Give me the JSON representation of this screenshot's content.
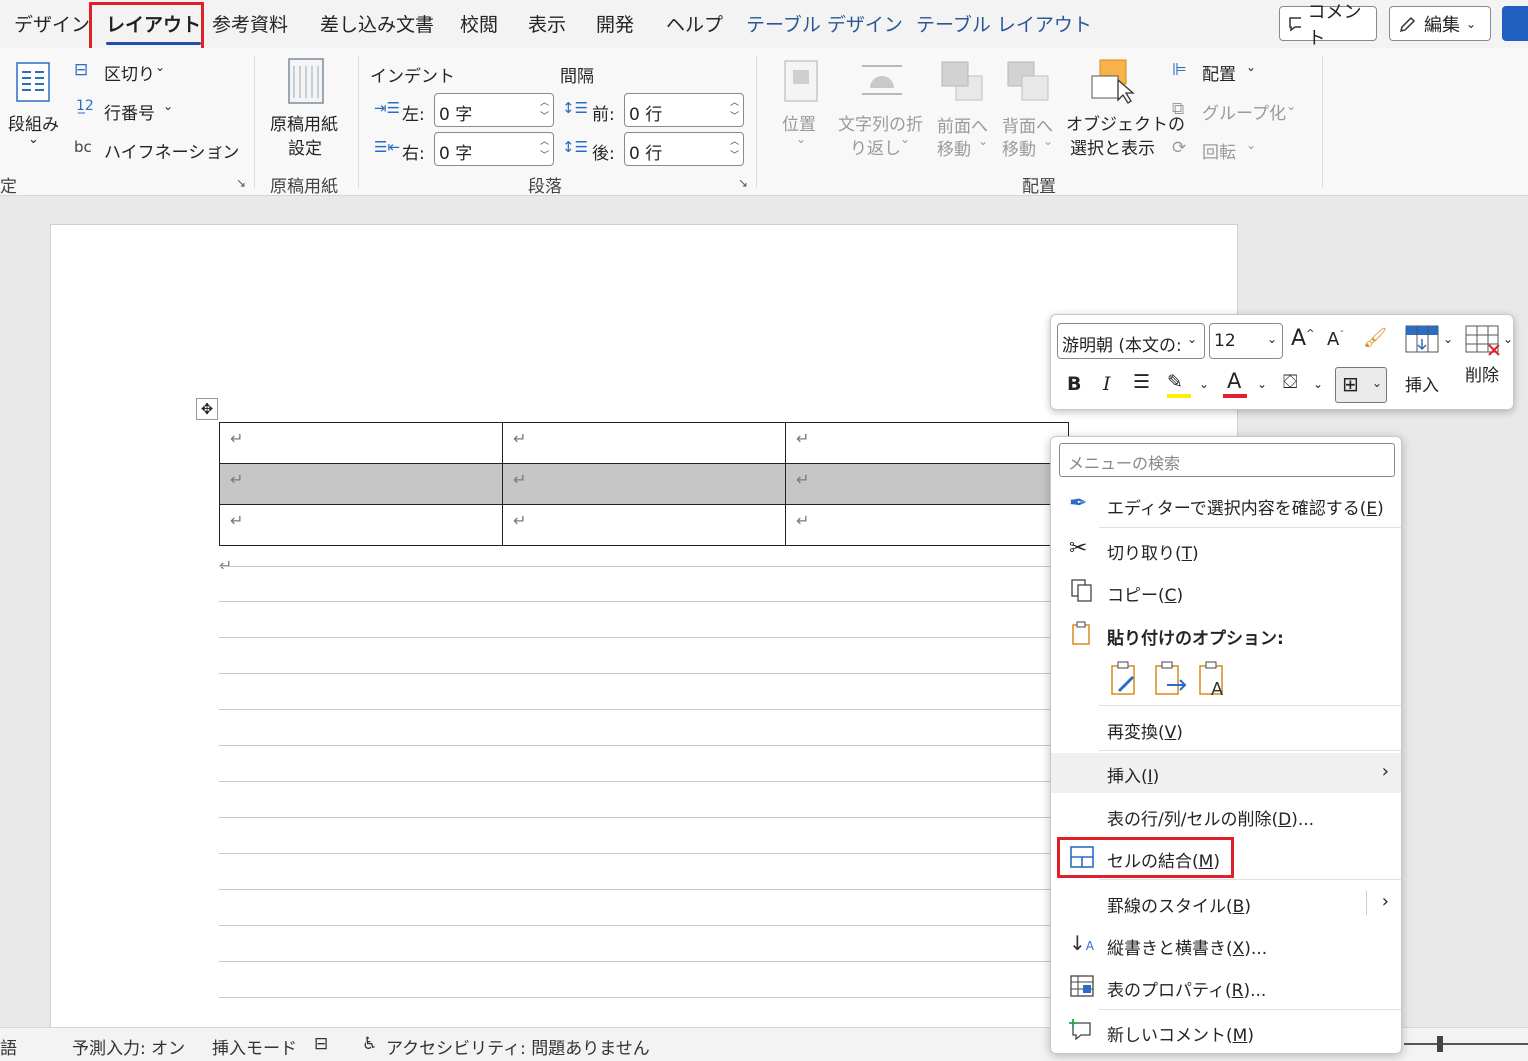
{
  "tabs": [
    {
      "label": "デザイン",
      "active": false,
      "contextual": false
    },
    {
      "label": "レイアウト",
      "active": true,
      "contextual": false
    },
    {
      "label": "参考資料",
      "active": false,
      "contextual": false
    },
    {
      "label": "差し込み文書",
      "active": false,
      "contextual": false
    },
    {
      "label": "校閲",
      "active": false,
      "contextual": false
    },
    {
      "label": "表示",
      "active": false,
      "contextual": false
    },
    {
      "label": "開発",
      "active": false,
      "contextual": false
    },
    {
      "label": "ヘルプ",
      "active": false,
      "contextual": false
    },
    {
      "label": "テーブル デザイン",
      "active": false,
      "contextual": true
    },
    {
      "label": "テーブル レイアウト",
      "active": false,
      "contextual": true
    }
  ],
  "top_buttons": {
    "comment": "コメント",
    "edit": "編集"
  },
  "ribbon": {
    "page_setup": {
      "columns": "段組み",
      "breaks": "区切り",
      "line_numbers": "行番号",
      "hyphenation": "ハイフネーション",
      "group_label": "定"
    },
    "genko": {
      "button": "原稿用紙\n設定",
      "button_line1": "原稿用紙",
      "button_line2": "設定",
      "group_label": "原稿用紙"
    },
    "paragraph": {
      "indent_title": "インデント",
      "spacing_title": "間隔",
      "left_label": "左:",
      "right_label": "右:",
      "before_label": "前:",
      "after_label": "後:",
      "left_value": "0 字",
      "right_value": "0 字",
      "before_value": "0 行",
      "after_value": "0 行",
      "group_label": "段落"
    },
    "arrange": {
      "position": "位置",
      "wrap_line1": "文字列の折",
      "wrap_line2": "り返し",
      "forward_line1": "前面へ",
      "forward_line2": "移動",
      "backward_line1": "背面へ",
      "backward_line2": "移動",
      "selection_line1": "オブジェクトの",
      "selection_line2": "選択と表示",
      "align": "配置",
      "group": "グループ化",
      "rotate": "回転",
      "group_label": "配置"
    }
  },
  "document": {
    "para_mark": "↵",
    "table": {
      "rows": 3,
      "cols": 3,
      "selected_row": 2
    }
  },
  "mini_toolbar": {
    "font": "游明朝 (本文の:",
    "size": "12",
    "insert": "挿入",
    "delete": "削除",
    "bold": "B",
    "italic": "I"
  },
  "context_menu": {
    "search_placeholder": "メニューの検索",
    "items": [
      {
        "label": "エディターで選択内容を確認する(",
        "key": "E",
        "suffix": ")"
      },
      {
        "label": "切り取り(",
        "key": "T",
        "suffix": ")"
      },
      {
        "label": "コピー(",
        "key": "C",
        "suffix": ")"
      },
      {
        "label": "貼り付けのオプション:",
        "key": "",
        "suffix": ""
      },
      {
        "label": "再変換(",
        "key": "V",
        "suffix": ")"
      },
      {
        "label": "挿入(",
        "key": "I",
        "suffix": ")"
      },
      {
        "label": "表の行/列/セルの削除(",
        "key": "D",
        "suffix": ")..."
      },
      {
        "label": "セルの結合(",
        "key": "M",
        "suffix": ")"
      },
      {
        "label": "罫線のスタイル(",
        "key": "B",
        "suffix": ")"
      },
      {
        "label": "縦書きと横書き(",
        "key": "X",
        "suffix": ")..."
      },
      {
        "label": "表のプロパティ(",
        "key": "R",
        "suffix": ")..."
      },
      {
        "label": "新しいコメント(",
        "key": "M",
        "suffix": ")"
      }
    ]
  },
  "statusbar": {
    "left_fragment": "語",
    "predictive": "予測入力: オン",
    "insert_mode": "挿入モード",
    "accessibility": "アクセシビリティ: 問題ありません"
  },
  "colors": {
    "highlight_red": "#e0202a",
    "accent_blue": "#1f4fa8",
    "highlighter_yellow": "#ffee00",
    "font_red": "#e0202a"
  }
}
